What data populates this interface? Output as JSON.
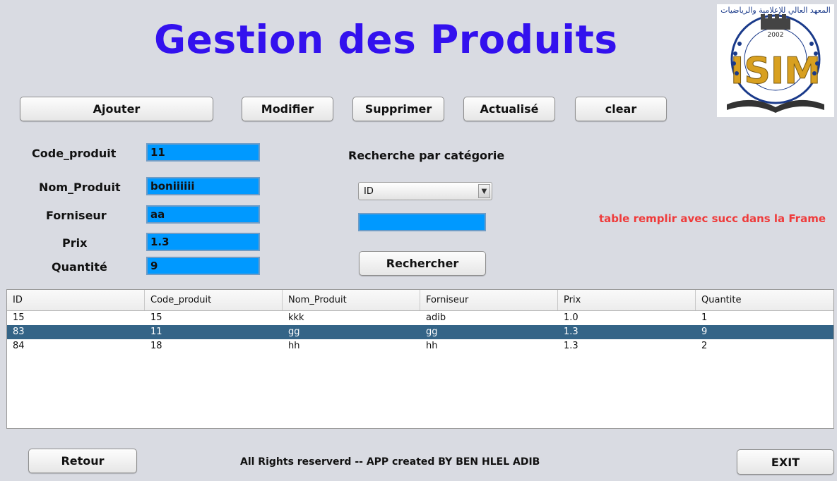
{
  "title": "Gestion des Produits",
  "logo": {
    "text": "ISIM",
    "year": "2002",
    "arabic": "المعهد العالي للإعلامية والرياضيات"
  },
  "actions": {
    "ajouter": "Ajouter",
    "modifier": "Modifier",
    "supprimer": "Supprimer",
    "actualise": "Actualisé",
    "clear": "clear"
  },
  "form": {
    "code_label": "Code_produit",
    "code_value": "11",
    "nom_label": "Nom_Produit",
    "nom_value": "boniiiiii",
    "fournisseur_label": "Forniseur",
    "fournisseur_value": "aa",
    "prix_label": "Prix",
    "prix_value": "1.3",
    "quantite_label": "Quantité",
    "quantite_value": "9"
  },
  "search": {
    "label": "Recherche par catégorie",
    "category": "ID",
    "query": "",
    "button": "Rechercher"
  },
  "status_message": "table remplir avec succ dans la Frame",
  "table": {
    "columns": [
      "ID",
      "Code_produit",
      "Nom_Produit",
      "Forniseur",
      "Prix",
      "Quantite"
    ],
    "rows": [
      [
        "15",
        "15",
        "kkk",
        "adib",
        "1.0",
        "1"
      ],
      [
        "83",
        "11",
        "gg",
        "gg",
        "1.3",
        "9"
      ],
      [
        "84",
        "18",
        "hh",
        "hh",
        "1.3",
        "2"
      ]
    ],
    "selected_row": 1
  },
  "footer": {
    "retour": "Retour",
    "credits": "All Rights reserverd -- APP created BY BEN HLEL ADIB",
    "exit": "EXIT"
  },
  "colors": {
    "title": "#3311ee",
    "field": "#0099ff",
    "status": "#ef3b3b",
    "selection": "#346487"
  }
}
